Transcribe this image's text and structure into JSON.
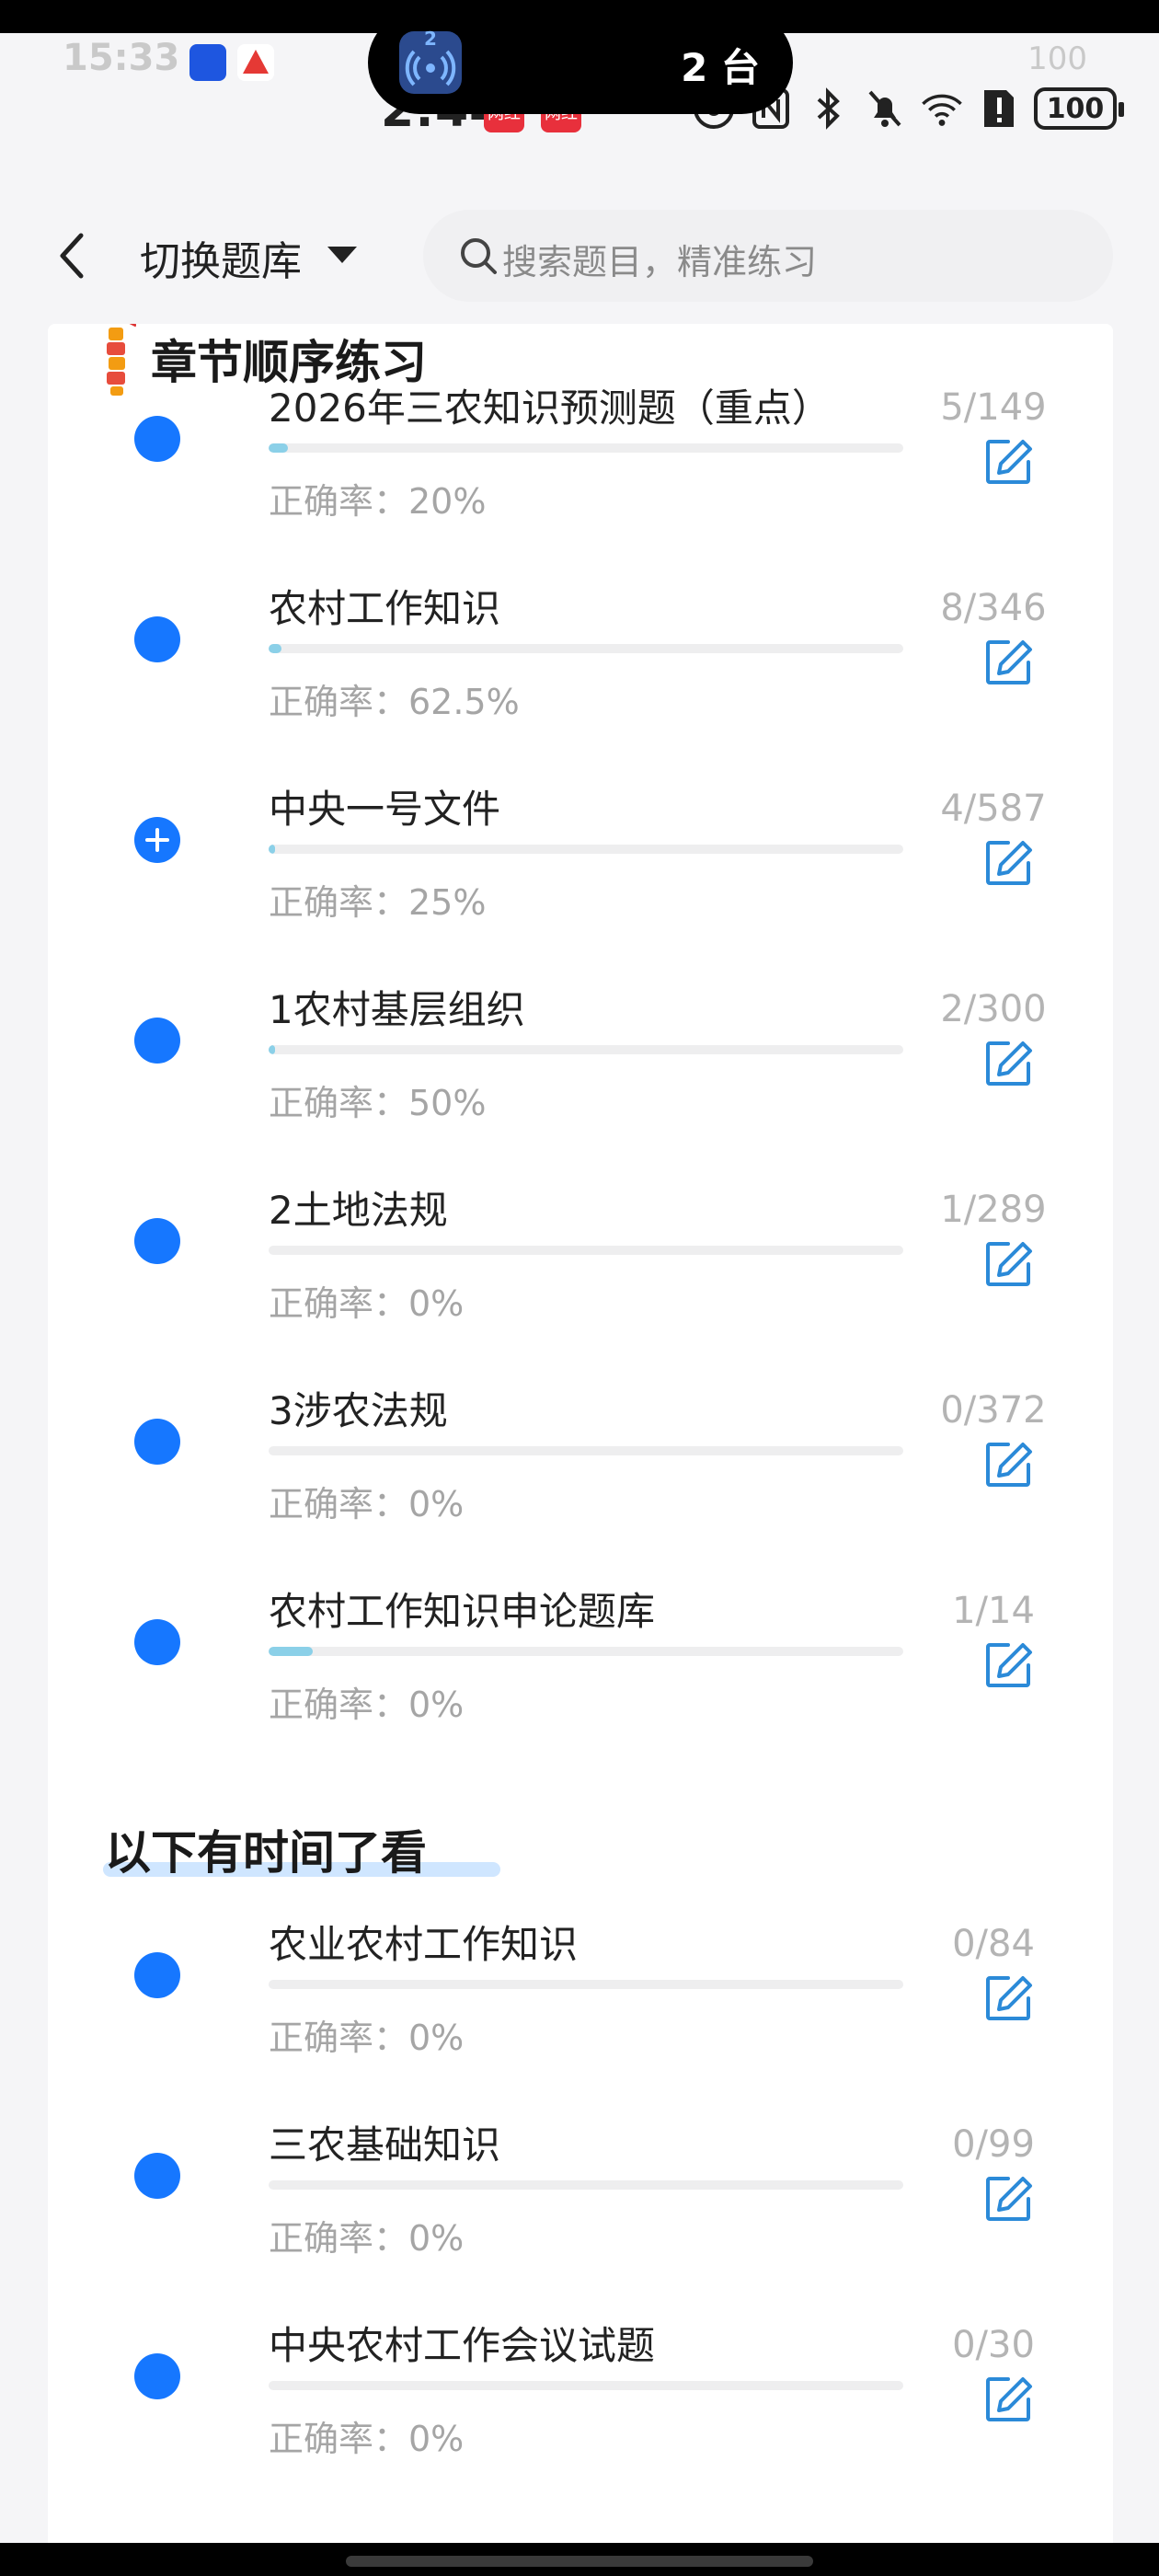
{
  "status": {
    "ghost_time": "15:33",
    "ghost_right": "100",
    "time": "2:44",
    "badge1": "网红",
    "badge2": "网红",
    "battery": "100",
    "island_badge": "2",
    "island_text": "2 台",
    "icons": [
      "eye-icon",
      "nfc-icon",
      "bluetooth-icon",
      "mute-icon",
      "wifi-icon",
      "sim-alert-icon"
    ]
  },
  "header": {
    "switch_label": "切换题库",
    "search_placeholder": "搜索题目，精准练习"
  },
  "sections": [
    {
      "title": "章节顺序练习",
      "items": [
        {
          "title": "2026年三农知识预测题（重点）",
          "accuracy": "正确率：20%",
          "count": "5/149",
          "progress": 0.03,
          "plus": false
        },
        {
          "title": "农村工作知识",
          "accuracy": "正确率：62.5%",
          "count": "8/346",
          "progress": 0.02,
          "plus": false
        },
        {
          "title": "中央一号文件",
          "accuracy": "正确率：25%",
          "count": "4/587",
          "progress": 0.01,
          "plus": true
        },
        {
          "title": "1农村基层组织",
          "accuracy": "正确率：50%",
          "count": "2/300",
          "progress": 0.01,
          "plus": false
        },
        {
          "title": "2土地法规",
          "accuracy": "正确率：0%",
          "count": "1/289",
          "progress": 0.0,
          "plus": false
        },
        {
          "title": "3涉农法规",
          "accuracy": "正确率：0%",
          "count": "0/372",
          "progress": 0.0,
          "plus": false
        },
        {
          "title": "农村工作知识申论题库",
          "accuracy": "正确率：0%",
          "count": "1/14",
          "progress": 0.07,
          "plus": false
        }
      ]
    },
    {
      "title": "以下有时间了看",
      "items": [
        {
          "title": "农业农村工作知识",
          "accuracy": "正确率：0%",
          "count": "0/84",
          "progress": 0.0,
          "plus": false
        },
        {
          "title": "三农基础知识",
          "accuracy": "正确率：0%",
          "count": "0/99",
          "progress": 0.0,
          "plus": false
        },
        {
          "title": "中央农村工作会议试题",
          "accuracy": "正确率：0%",
          "count": "0/30",
          "progress": 0.0,
          "plus": false
        }
      ]
    }
  ],
  "colors": {
    "accent": "#1677ff",
    "progress_fill": "#8bd0e8",
    "edit_icon": "#2b8ad8"
  }
}
